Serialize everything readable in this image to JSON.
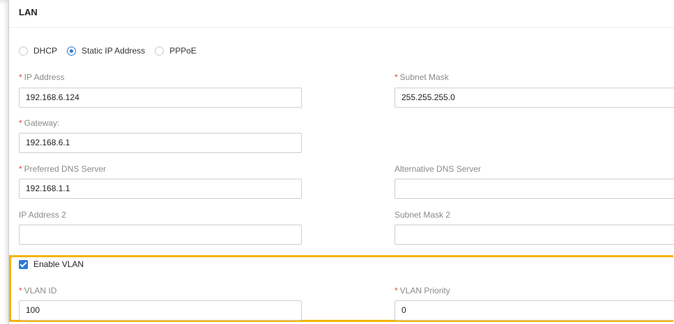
{
  "section": {
    "title": "LAN"
  },
  "ip_mode": {
    "options": [
      {
        "label": "DHCP",
        "selected": false
      },
      {
        "label": "Static IP Address",
        "selected": true
      },
      {
        "label": "PPPoE",
        "selected": false
      }
    ]
  },
  "fields": {
    "ip_address": {
      "label": "IP Address",
      "required": "*",
      "value": "192.168.6.124"
    },
    "subnet_mask": {
      "label": "Subnet Mask",
      "required": "*",
      "value": "255.255.255.0"
    },
    "gateway": {
      "label": "Gateway:",
      "required": "*",
      "value": "192.168.6.1"
    },
    "preferred_dns": {
      "label": "Preferred DNS Server",
      "required": "*",
      "value": "192.168.1.1"
    },
    "alternative_dns": {
      "label": "Alternative DNS Server",
      "value": ""
    },
    "ip_address_2": {
      "label": "IP Address 2",
      "value": ""
    },
    "subnet_mask_2": {
      "label": "Subnet Mask 2",
      "value": ""
    }
  },
  "vlan": {
    "enable_label": "Enable VLAN",
    "enabled": true,
    "vlan_id": {
      "label": "VLAN ID",
      "required": "*",
      "value": "100"
    },
    "vlan_priority": {
      "label": "VLAN Priority",
      "required": "*",
      "value": "0"
    }
  },
  "colors": {
    "accent": "#2d7ad6",
    "required": "#e0463a",
    "highlight": "#f4b400"
  }
}
